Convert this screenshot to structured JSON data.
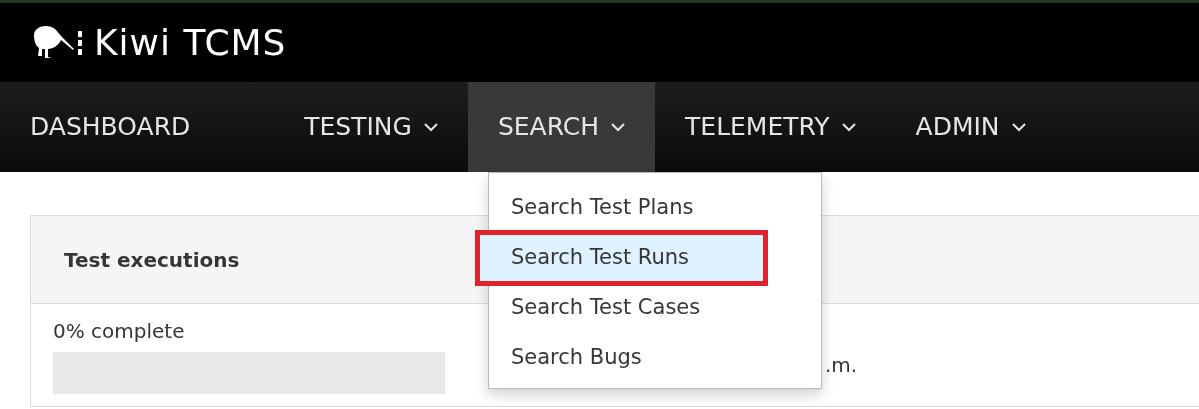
{
  "brand": {
    "name": "Kiwi TCMS"
  },
  "nav": [
    {
      "label": "DASHBOARD",
      "dropdown": false,
      "selected": false
    },
    {
      "label": "TESTING",
      "dropdown": true,
      "selected": false
    },
    {
      "label": "SEARCH",
      "dropdown": true,
      "selected": true
    },
    {
      "label": "TELEMETRY",
      "dropdown": true,
      "selected": false
    },
    {
      "label": "ADMIN",
      "dropdown": true,
      "selected": false
    }
  ],
  "menu": [
    {
      "label": "Search Test Plans",
      "selected": false,
      "annotated": false
    },
    {
      "label": "Search Test Runs",
      "selected": true,
      "annotated": true
    },
    {
      "label": "Search Test Cases",
      "selected": false,
      "annotated": false
    },
    {
      "label": "Search Bugs",
      "selected": false,
      "annotated": false
    }
  ],
  "panel": {
    "title": "Test executions",
    "progress_label": "0% complete",
    "level": 0,
    "column_2": ".m."
  }
}
